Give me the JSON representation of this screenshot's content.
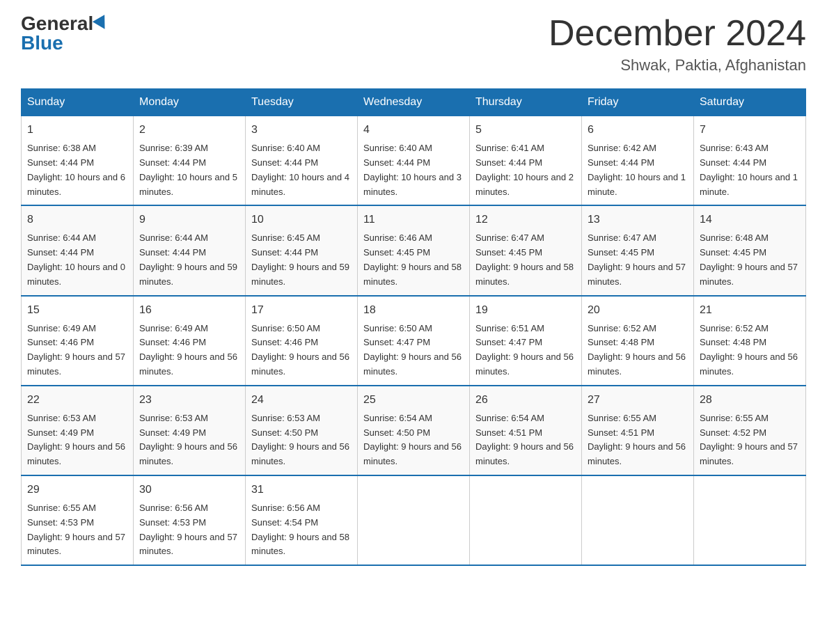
{
  "logo": {
    "general": "General",
    "blue": "Blue"
  },
  "title": {
    "month": "December 2024",
    "location": "Shwak, Paktia, Afghanistan"
  },
  "headers": [
    "Sunday",
    "Monday",
    "Tuesday",
    "Wednesday",
    "Thursday",
    "Friday",
    "Saturday"
  ],
  "weeks": [
    [
      {
        "day": "1",
        "sunrise": "6:38 AM",
        "sunset": "4:44 PM",
        "daylight": "10 hours and 6 minutes."
      },
      {
        "day": "2",
        "sunrise": "6:39 AM",
        "sunset": "4:44 PM",
        "daylight": "10 hours and 5 minutes."
      },
      {
        "day": "3",
        "sunrise": "6:40 AM",
        "sunset": "4:44 PM",
        "daylight": "10 hours and 4 minutes."
      },
      {
        "day": "4",
        "sunrise": "6:40 AM",
        "sunset": "4:44 PM",
        "daylight": "10 hours and 3 minutes."
      },
      {
        "day": "5",
        "sunrise": "6:41 AM",
        "sunset": "4:44 PM",
        "daylight": "10 hours and 2 minutes."
      },
      {
        "day": "6",
        "sunrise": "6:42 AM",
        "sunset": "4:44 PM",
        "daylight": "10 hours and 1 minute."
      },
      {
        "day": "7",
        "sunrise": "6:43 AM",
        "sunset": "4:44 PM",
        "daylight": "10 hours and 1 minute."
      }
    ],
    [
      {
        "day": "8",
        "sunrise": "6:44 AM",
        "sunset": "4:44 PM",
        "daylight": "10 hours and 0 minutes."
      },
      {
        "day": "9",
        "sunrise": "6:44 AM",
        "sunset": "4:44 PM",
        "daylight": "9 hours and 59 minutes."
      },
      {
        "day": "10",
        "sunrise": "6:45 AM",
        "sunset": "4:44 PM",
        "daylight": "9 hours and 59 minutes."
      },
      {
        "day": "11",
        "sunrise": "6:46 AM",
        "sunset": "4:45 PM",
        "daylight": "9 hours and 58 minutes."
      },
      {
        "day": "12",
        "sunrise": "6:47 AM",
        "sunset": "4:45 PM",
        "daylight": "9 hours and 58 minutes."
      },
      {
        "day": "13",
        "sunrise": "6:47 AM",
        "sunset": "4:45 PM",
        "daylight": "9 hours and 57 minutes."
      },
      {
        "day": "14",
        "sunrise": "6:48 AM",
        "sunset": "4:45 PM",
        "daylight": "9 hours and 57 minutes."
      }
    ],
    [
      {
        "day": "15",
        "sunrise": "6:49 AM",
        "sunset": "4:46 PM",
        "daylight": "9 hours and 57 minutes."
      },
      {
        "day": "16",
        "sunrise": "6:49 AM",
        "sunset": "4:46 PM",
        "daylight": "9 hours and 56 minutes."
      },
      {
        "day": "17",
        "sunrise": "6:50 AM",
        "sunset": "4:46 PM",
        "daylight": "9 hours and 56 minutes."
      },
      {
        "day": "18",
        "sunrise": "6:50 AM",
        "sunset": "4:47 PM",
        "daylight": "9 hours and 56 minutes."
      },
      {
        "day": "19",
        "sunrise": "6:51 AM",
        "sunset": "4:47 PM",
        "daylight": "9 hours and 56 minutes."
      },
      {
        "day": "20",
        "sunrise": "6:52 AM",
        "sunset": "4:48 PM",
        "daylight": "9 hours and 56 minutes."
      },
      {
        "day": "21",
        "sunrise": "6:52 AM",
        "sunset": "4:48 PM",
        "daylight": "9 hours and 56 minutes."
      }
    ],
    [
      {
        "day": "22",
        "sunrise": "6:53 AM",
        "sunset": "4:49 PM",
        "daylight": "9 hours and 56 minutes."
      },
      {
        "day": "23",
        "sunrise": "6:53 AM",
        "sunset": "4:49 PM",
        "daylight": "9 hours and 56 minutes."
      },
      {
        "day": "24",
        "sunrise": "6:53 AM",
        "sunset": "4:50 PM",
        "daylight": "9 hours and 56 minutes."
      },
      {
        "day": "25",
        "sunrise": "6:54 AM",
        "sunset": "4:50 PM",
        "daylight": "9 hours and 56 minutes."
      },
      {
        "day": "26",
        "sunrise": "6:54 AM",
        "sunset": "4:51 PM",
        "daylight": "9 hours and 56 minutes."
      },
      {
        "day": "27",
        "sunrise": "6:55 AM",
        "sunset": "4:51 PM",
        "daylight": "9 hours and 56 minutes."
      },
      {
        "day": "28",
        "sunrise": "6:55 AM",
        "sunset": "4:52 PM",
        "daylight": "9 hours and 57 minutes."
      }
    ],
    [
      {
        "day": "29",
        "sunrise": "6:55 AM",
        "sunset": "4:53 PM",
        "daylight": "9 hours and 57 minutes."
      },
      {
        "day": "30",
        "sunrise": "6:56 AM",
        "sunset": "4:53 PM",
        "daylight": "9 hours and 57 minutes."
      },
      {
        "day": "31",
        "sunrise": "6:56 AM",
        "sunset": "4:54 PM",
        "daylight": "9 hours and 58 minutes."
      },
      null,
      null,
      null,
      null
    ]
  ],
  "labels": {
    "sunrise_prefix": "Sunrise: ",
    "sunset_prefix": "Sunset: ",
    "daylight_prefix": "Daylight: "
  }
}
